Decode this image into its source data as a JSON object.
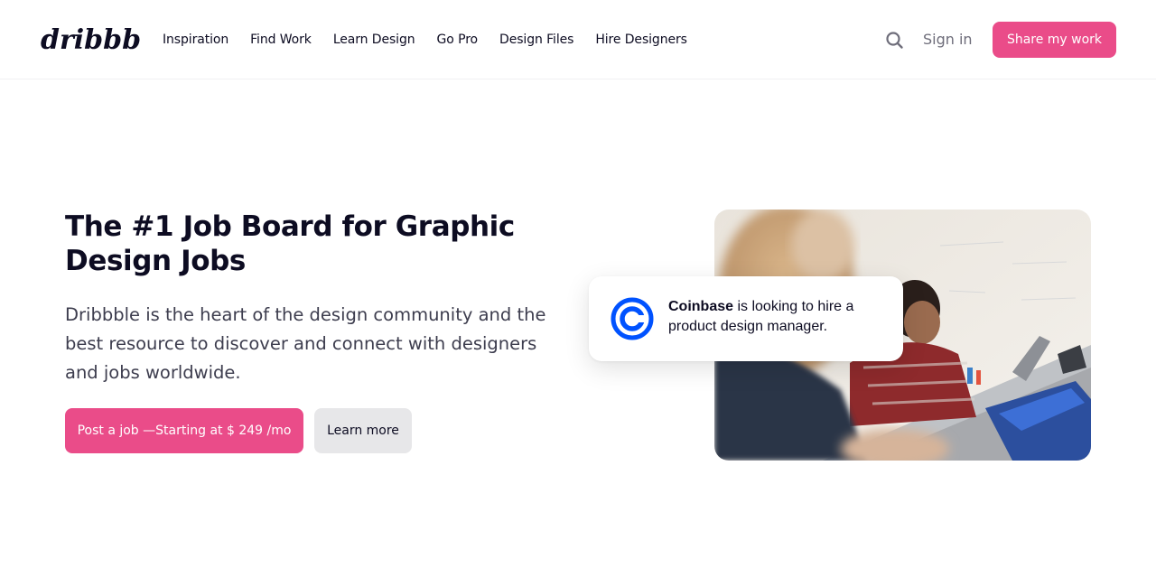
{
  "header": {
    "logo_text": "dribbble",
    "nav": [
      {
        "label": "Inspiration"
      },
      {
        "label": "Find Work"
      },
      {
        "label": "Learn Design"
      },
      {
        "label": "Go Pro"
      },
      {
        "label": "Design Files"
      },
      {
        "label": "Hire Designers"
      }
    ],
    "search_icon": "search-icon",
    "sign_in": "Sign in",
    "share_button": "Share my work"
  },
  "hero": {
    "title": "The #1 Job Board for Graphic Design Jobs",
    "description": "Dribbble is the heart of the design community and the best resource to discover and connect with designers and jobs worldwide.",
    "post_button": "Post a job —Starting at $ 249 /mo",
    "learn_button": "Learn more"
  },
  "hiring_card": {
    "company": "Coinbase",
    "message": " is looking to hire a product design manager.",
    "logo_icon": "coinbase-logo-icon"
  },
  "colors": {
    "brand_pink": "#ea4c89",
    "coinbase_blue": "#0052ff",
    "text_dark": "#0d0c22",
    "text_muted": "#6e6d7a"
  }
}
